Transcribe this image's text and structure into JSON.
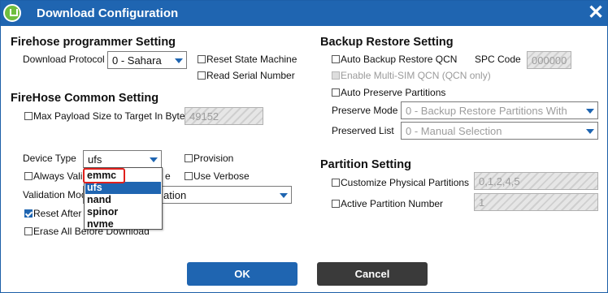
{
  "window": {
    "title": "Download Configuration",
    "close_label": "✕"
  },
  "firehose_programmer": {
    "heading": "Firehose programmer Setting",
    "protocol_label": "Download Protocol",
    "protocol_value": "0 - Sahara",
    "reset_state_machine": "Reset State Machine",
    "read_serial_number": "Read Serial Number"
  },
  "firehose_common": {
    "heading": "FireHose Common Setting",
    "max_payload_label": "Max Payload Size to Target In Byte",
    "max_payload_value": "49152",
    "device_type_label": "Device Type",
    "device_type_value": "ufs",
    "provision": "Provision",
    "always_validate": "Always Vali",
    "always_validate_tail": "e",
    "use_verbose": "Use Verbose",
    "validation_mode_label": "Validation Mode",
    "validation_mode_value": "ation",
    "reset_after": "Reset After D",
    "erase_all": "Erase All Before Download"
  },
  "device_type_options": [
    "emmc",
    "ufs",
    "nand",
    "spinor",
    "nvme"
  ],
  "backup_restore": {
    "heading": "Backup Restore Setting",
    "auto_backup": "Auto Backup Restore QCN",
    "spc_label": "SPC Code",
    "spc_value": "000000",
    "multi_sim": "Enable Multi-SIM QCN (QCN only)",
    "auto_preserve": "Auto Preserve Partitions",
    "preserve_mode_label": "Preserve Mode",
    "preserve_mode_value": "0 - Backup Restore Partitions With",
    "preserved_list_label": "Preserved List",
    "preserved_list_value": "0 - Manual Selection"
  },
  "partition": {
    "heading": "Partition Setting",
    "customize": "Customize Physical Partitions",
    "customize_value": "0,1,2,4,5",
    "active": "Active Partition Number",
    "active_value": "1"
  },
  "buttons": {
    "ok": "OK",
    "cancel": "Cancel"
  },
  "colors": {
    "title_bar": "#1f65b1",
    "ok_button": "#1f65b1",
    "cancel_button": "#3a3a3a",
    "highlight_box": "#e0201c"
  }
}
